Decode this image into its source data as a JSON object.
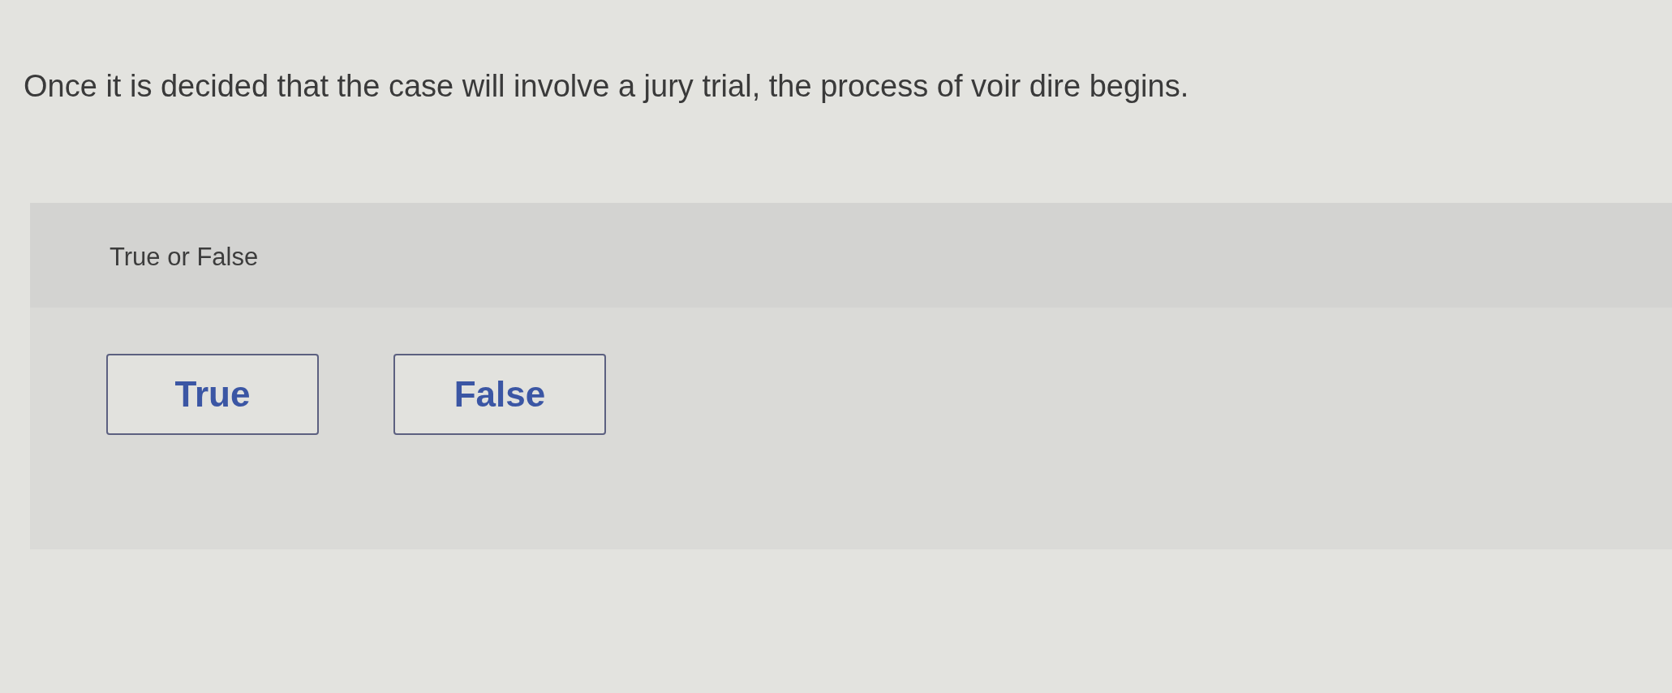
{
  "question": {
    "text": "Once it is decided that the case will involve a jury trial, the process of voir dire begins."
  },
  "answer_panel": {
    "prompt": "True or False",
    "options": [
      {
        "label": "True",
        "selected": false
      },
      {
        "label": "False",
        "selected": false
      }
    ]
  }
}
